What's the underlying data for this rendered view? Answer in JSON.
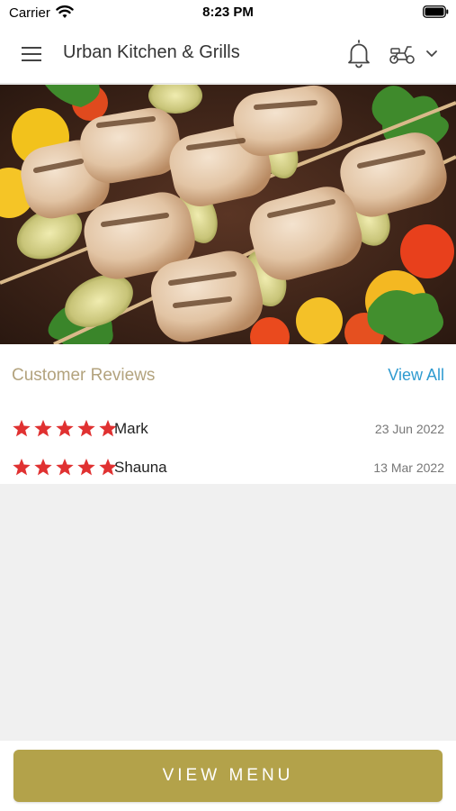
{
  "status_bar": {
    "carrier": "Carrier",
    "time": "8:23 PM"
  },
  "header": {
    "title": "Urban Kitchen & Grills",
    "icons": [
      "menu-icon",
      "bell-icon",
      "scooter-icon",
      "chevron-down-icon"
    ]
  },
  "hero": {
    "image": "grilled chicken and leek skewers with tomatoes and parsley"
  },
  "reviews": {
    "heading": "Customer Reviews",
    "view_all": "View All",
    "items": [
      {
        "name": "Mark",
        "date": "23 Jun 2022",
        "rating": 5
      },
      {
        "name": "Shauna",
        "date": "13 Mar 2022",
        "rating": 5
      }
    ]
  },
  "footer": {
    "button": "VIEW MENU"
  },
  "colors": {
    "accent": "#b3a24a",
    "heading": "#b3a37e",
    "link": "#2f9bd0",
    "star": "#e03131"
  }
}
